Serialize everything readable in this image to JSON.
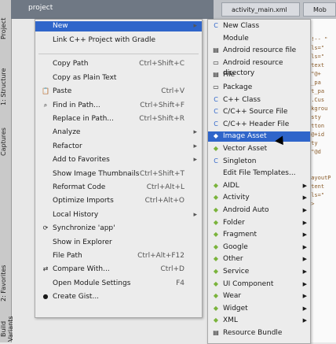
{
  "window": {
    "project_label": "project"
  },
  "side_tabs": [
    "Project",
    "1: Structure",
    "Captures",
    "2: Favorites",
    "Build Variants"
  ],
  "tabs": [
    {
      "label": "activity_main.xml"
    },
    {
      "label": "Mob"
    }
  ],
  "editor_lines": [
    "",
    "",
    "<!-- \"",
    "ols=\"",
    "ols=\"",
    "/text",
    "=\"@+",
    "h_pa",
    "ht_pa",
    "\".Cus",
    "ckgrou",
    "@sty",
    "utton",
    "\"@+id",
    "sty",
    "=\"@d",
    "",
    "",
    "LayoutP",
    "ntent",
    "ols=\"",
    "1>",
    "",
    ""
  ],
  "context_menu": {
    "items": [
      {
        "label": "New",
        "highlighted": true,
        "submenu": true
      },
      {
        "label": "Link C++ Project with Gradle",
        "icon": ""
      },
      {
        "label": "",
        "separator": true
      },
      {
        "label": "Copy Path",
        "shortcut": "Ctrl+Shift+C"
      },
      {
        "label": "Copy as Plain Text"
      },
      {
        "label": "Paste",
        "shortcut": "Ctrl+V",
        "icon": "paste-icon"
      },
      {
        "label": "Find in Path...",
        "shortcut": "Ctrl+Shift+F",
        "icon": "search-icon"
      },
      {
        "label": "Replace in Path...",
        "shortcut": "Ctrl+Shift+R"
      },
      {
        "label": "Analyze",
        "submenu": true
      },
      {
        "label": "Refactor",
        "submenu": true
      },
      {
        "label": "Add to Favorites",
        "submenu": true
      },
      {
        "label": "Show Image Thumbnails",
        "shortcut": "Ctrl+Shift+T"
      },
      {
        "label": "Reformat Code",
        "shortcut": "Ctrl+Alt+L"
      },
      {
        "label": "Optimize Imports",
        "shortcut": "Ctrl+Alt+O"
      },
      {
        "label": "Local History",
        "submenu": true
      },
      {
        "label": "Synchronize 'app'",
        "icon": "sync-icon"
      },
      {
        "label": "Show in Explorer"
      },
      {
        "label": "File Path",
        "shortcut": "Ctrl+Alt+F12"
      },
      {
        "label": "Compare With...",
        "shortcut": "Ctrl+D",
        "icon": "compare-icon"
      },
      {
        "label": "Open Module Settings",
        "shortcut": "F4"
      },
      {
        "label": "Create Gist...",
        "icon": "github-icon"
      }
    ]
  },
  "new_submenu": {
    "items": [
      {
        "label": "New Class",
        "icon": "class-icon"
      },
      {
        "label": "Module",
        "icon": ""
      },
      {
        "label": "Android resource file",
        "icon": "file-icon"
      },
      {
        "label": "Android resource directory",
        "icon": "folder-icon"
      },
      {
        "label": "File",
        "icon": "file-icon"
      },
      {
        "label": "Package",
        "icon": "folder-icon"
      },
      {
        "label": "C++ Class",
        "icon": "cpp-icon"
      },
      {
        "label": "C/C++ Source File",
        "icon": "cpp-icon"
      },
      {
        "label": "C/C++ Header File",
        "icon": "cpp-icon"
      },
      {
        "label": "Image Asset",
        "icon": "android-icon",
        "highlighted": true
      },
      {
        "label": "Vector Asset",
        "icon": "android-icon"
      },
      {
        "label": "Singleton",
        "icon": "class-icon"
      },
      {
        "label": "Edit File Templates...",
        "icon": ""
      },
      {
        "label": "AIDL",
        "icon": "android-icon",
        "submenu": true
      },
      {
        "label": "Activity",
        "icon": "android-icon",
        "submenu": true
      },
      {
        "label": "Android Auto",
        "icon": "android-icon",
        "submenu": true
      },
      {
        "label": "Folder",
        "icon": "android-icon",
        "submenu": true
      },
      {
        "label": "Fragment",
        "icon": "android-icon",
        "submenu": true
      },
      {
        "label": "Google",
        "icon": "android-icon",
        "submenu": true
      },
      {
        "label": "Other",
        "icon": "android-icon",
        "submenu": true
      },
      {
        "label": "Service",
        "icon": "android-icon",
        "submenu": true
      },
      {
        "label": "UI Component",
        "icon": "android-icon",
        "submenu": true
      },
      {
        "label": "Wear",
        "icon": "android-icon",
        "submenu": true
      },
      {
        "label": "Widget",
        "icon": "android-icon",
        "submenu": true
      },
      {
        "label": "XML",
        "icon": "android-icon",
        "submenu": true
      },
      {
        "label": "Resource Bundle",
        "icon": "file-icon"
      }
    ]
  }
}
